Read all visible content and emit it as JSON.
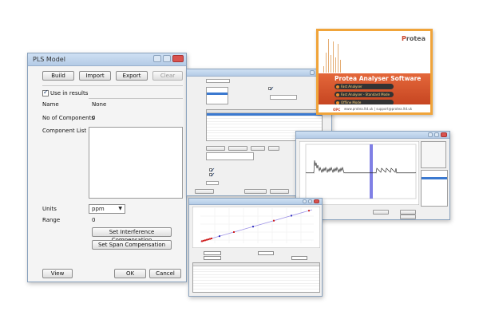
{
  "pls_window": {
    "title": "PLS Model",
    "build_label": "Build",
    "import_label": "Import",
    "export_label": "Export",
    "clear_label": "Clear",
    "use_in_results_label": "Use in results",
    "name_label": "Name",
    "name_value": "None",
    "num_components_label": "No of Components",
    "num_components_value": "0",
    "component_list_label": "Component List",
    "units_label": "Units",
    "units_value": "ppm",
    "range_label": "Range",
    "range_value": "0",
    "set_interference_label": "Set Interference Compensation",
    "set_span_label": "Set Span Compensation",
    "view_label": "View",
    "ok_label": "OK",
    "cancel_label": "Cancel"
  },
  "software_box": {
    "brand_prefix": "P",
    "brand_rest": "rotea",
    "title": "Protea Analyser Software",
    "items": [
      "Fast Analyser",
      "Fast Analyser - Standard Mode",
      "Offline Mode"
    ],
    "sponsor": "OPC",
    "website": "www.protea.ltd.uk  |  support@protea.ltd.uk"
  },
  "colors": {
    "accent_orange": "#f0a43a",
    "band_red": "#d4532c",
    "selection_blue": "#3b79d0",
    "spectrum_marker": "#6a6ae0",
    "calibration_line": "#9f94e6",
    "calibration_points": "#d02020"
  }
}
